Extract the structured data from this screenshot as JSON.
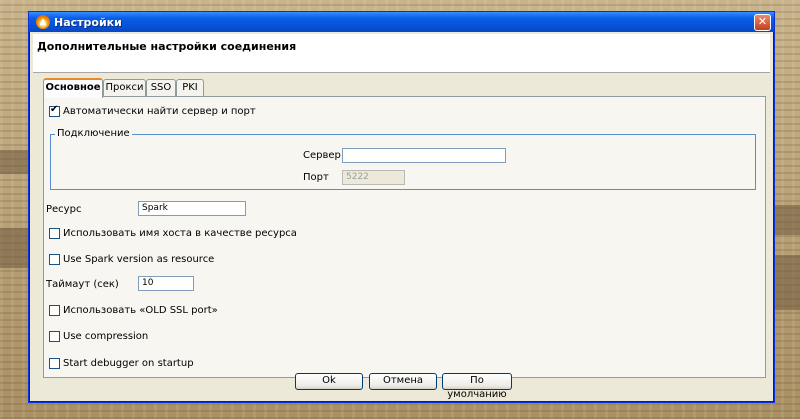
{
  "window": {
    "title": "Настройки",
    "heading": "Дополнительные настройки соединения"
  },
  "tabs": [
    {
      "label": "Основное",
      "active": true
    },
    {
      "label": "Прокси",
      "active": false
    },
    {
      "label": "SSO",
      "active": false
    },
    {
      "label": "PKI",
      "active": false
    }
  ],
  "main": {
    "auto_find": {
      "label": "Автоматически найти сервер и порт",
      "checked": true
    },
    "connection_group": {
      "legend": "Подключение",
      "server_label": "Сервер",
      "server_value": "",
      "port_label": "Порт",
      "port_value": "5222"
    },
    "resource_label": "Ресурс",
    "resource_value": "Spark",
    "use_hostname": {
      "label": "Использовать имя хоста в качестве ресурса",
      "checked": false
    },
    "use_spark_version": {
      "label": "Use Spark version as resource",
      "checked": false
    },
    "timeout_label": "Таймаут (сек)",
    "timeout_value": "10",
    "old_ssl": {
      "label": "Использовать «OLD SSL port»",
      "checked": false
    },
    "compression": {
      "label": "Use compression",
      "checked": false
    },
    "debugger": {
      "label": "Start debugger on startup",
      "checked": false
    }
  },
  "buttons": {
    "ok": "Ok",
    "cancel": "Отмена",
    "defaults": "По умолчанию"
  },
  "colors": {
    "titlebar": "#0a5ee8",
    "active_tab_accent": "#e68b2c",
    "group_border": "#5a8ccf"
  }
}
